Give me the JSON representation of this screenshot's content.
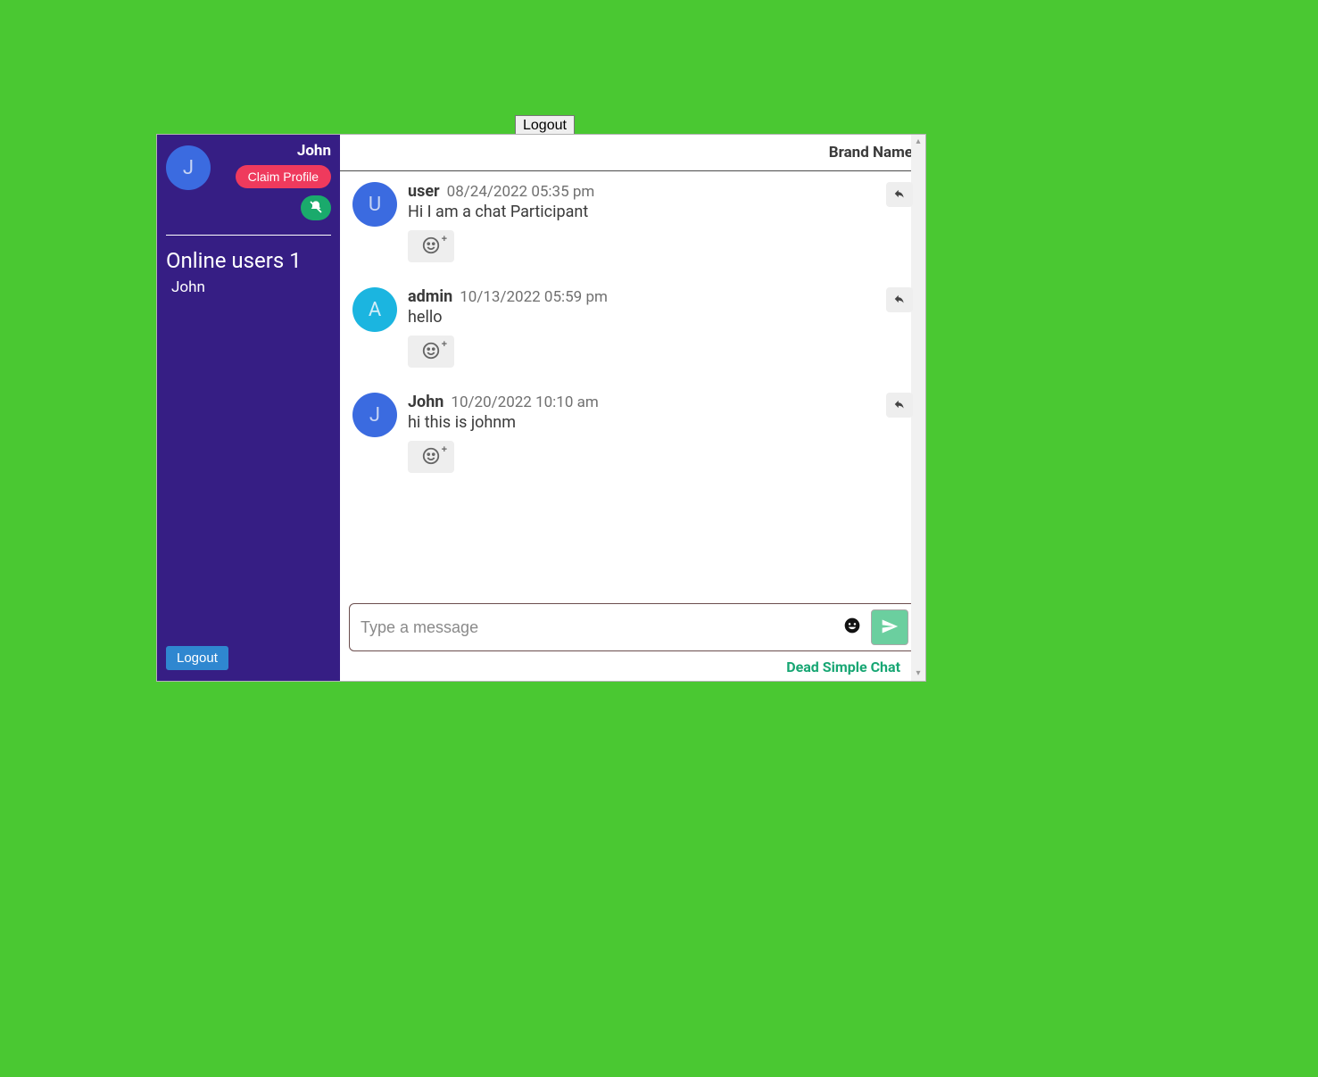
{
  "top_logout_label": "Logout",
  "sidebar": {
    "profile_name": "John",
    "avatar_initial": "J",
    "claim_profile_label": "Claim Profile",
    "online_heading": "Online users 1",
    "online_users": [
      "John"
    ],
    "logout_label": "Logout"
  },
  "header": {
    "brand": "Brand Name"
  },
  "messages": [
    {
      "author": "user",
      "timestamp": "08/24/2022 05:35 pm",
      "text": "Hi I am a chat Participant",
      "avatar_initial": "U",
      "avatar_color": "blue"
    },
    {
      "author": "admin",
      "timestamp": "10/13/2022 05:59 pm",
      "text": "hello",
      "avatar_initial": "A",
      "avatar_color": "cyan"
    },
    {
      "author": "John",
      "timestamp": "10/20/2022 10:10 am",
      "text": "hi this is johnm",
      "avatar_initial": "J",
      "avatar_color": "blue"
    }
  ],
  "composer": {
    "placeholder": "Type a message",
    "value": ""
  },
  "footer_link": "Dead Simple Chat"
}
